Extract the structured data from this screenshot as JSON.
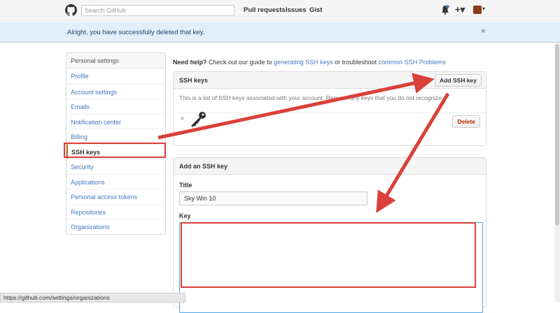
{
  "header": {
    "search_placeholder": "Search GitHub",
    "nav": [
      "Pull requests",
      "Issues",
      "Gist"
    ],
    "icons": [
      "github-logo-icon",
      "bell-icon",
      "plus-icon",
      "avatar-icon"
    ]
  },
  "flash": {
    "message": "Alright, you have successfully deleted that key.",
    "close": "×"
  },
  "sidebar": {
    "heading": "Personal settings",
    "items": [
      {
        "label": "Profile"
      },
      {
        "label": "Account settings"
      },
      {
        "label": "Emails"
      },
      {
        "label": "Notification center"
      },
      {
        "label": "Billing"
      },
      {
        "label": "SSH keys"
      },
      {
        "label": "Security"
      },
      {
        "label": "Applications"
      },
      {
        "label": "Personal access tokens"
      },
      {
        "label": "Repositories"
      },
      {
        "label": "Organizations"
      }
    ]
  },
  "help": {
    "prefix": "Need help?",
    "text1": " Check out our guide to ",
    "link1": "generating SSH keys",
    "text2": " or troubleshoot ",
    "link2": "common SSH Problems"
  },
  "ssh_keys": {
    "title": "SSH keys",
    "add_button": "Add SSH key",
    "description": "This is a list of SSH keys associated with your account. Remove any keys that you do not recognize.",
    "delete_button": "Delete"
  },
  "add_key": {
    "title": "Add an SSH key",
    "title_label": "Title",
    "title_value": "Sky Win 10",
    "key_label": "Key",
    "key_value": ""
  },
  "statusbar": {
    "url": "https://github.com/settings/organizations"
  },
  "colors": {
    "accent": "#4078c0",
    "annotation": "#d9403a"
  }
}
